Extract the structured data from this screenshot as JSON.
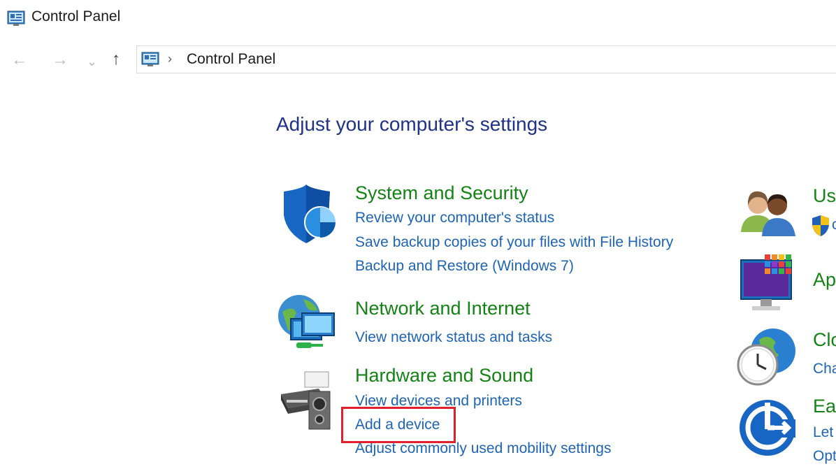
{
  "window": {
    "title": "Control Panel"
  },
  "nav": {
    "back_glyph": "←",
    "forward_glyph": "→",
    "recent_glyph": "⌄",
    "up_glyph": "↑",
    "breadcrumb_sep": "›",
    "address": "Control Panel"
  },
  "main": {
    "heading": "Adjust your computer's settings",
    "categories": [
      {
        "title": "System and Security",
        "icon": "shield-icon",
        "links": [
          "Review your computer's status",
          "Save backup copies of your files with File History",
          "Backup and Restore (Windows 7)"
        ]
      },
      {
        "title": "Network and Internet",
        "icon": "network-globe-icon",
        "links": [
          "View network status and tasks"
        ]
      },
      {
        "title": "Hardware and Sound",
        "icon": "printer-speaker-icon",
        "links": [
          "View devices and printers",
          "Add a device",
          "Adjust commonly used mobility settings"
        ]
      }
    ],
    "right_categories": [
      {
        "title": "Us",
        "icon": "users-icon",
        "link": "",
        "link_icon": "uac-shield-icon",
        "link_glyph": "c"
      },
      {
        "title": "Ap",
        "icon": "programs-icon",
        "link": ""
      },
      {
        "title": "Clo",
        "icon": "clock-globe-icon",
        "link": "Cha"
      },
      {
        "title": "Eas",
        "icon": "ease-of-access-icon",
        "links": [
          "Let",
          "Opt"
        ]
      }
    ]
  },
  "colors": {
    "heading": "#1e3287",
    "category_title": "#148214",
    "link": "#1e64b4",
    "highlight": "#e0202a"
  }
}
